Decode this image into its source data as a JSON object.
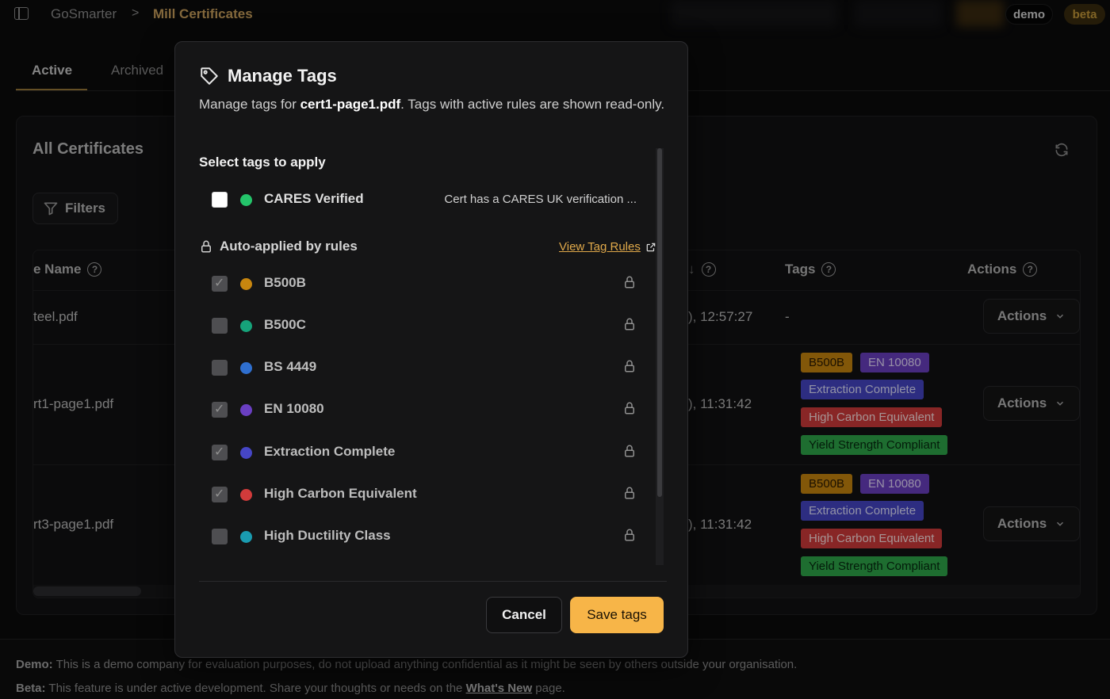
{
  "breadcrumb": {
    "home": "GoSmarter",
    "separator": ">",
    "current": "Mill Certificates"
  },
  "badges": {
    "demo": "demo",
    "beta": "beta"
  },
  "tabs": [
    {
      "label": "Active"
    },
    {
      "label": "Archived"
    }
  ],
  "card": {
    "title": "All Certificates",
    "filters_label": "Filters"
  },
  "table": {
    "columns": {
      "name": "e Name",
      "date_sort": "↓",
      "tags": "Tags",
      "actions": "Actions"
    },
    "rows": [
      {
        "name": "teel.pdf",
        "date": "), 12:57:27",
        "tags_empty": "-",
        "action": "Actions"
      },
      {
        "name": "rt1-page1.pdf",
        "date": "), 11:31:42",
        "action": "Actions"
      },
      {
        "name": "rt3-page1.pdf",
        "date": "), 11:31:42",
        "action": "Actions"
      }
    ],
    "tag_chips": [
      "B500B",
      "EN 10080",
      "Extraction Complete",
      "High Carbon Equivalent",
      "Yield Strength Compliant"
    ]
  },
  "colors": {
    "accent": "#f7b548",
    "tag_b500b": "#c8860f",
    "tag_en10080": "#6a3fc2",
    "tag_extraction": "#4646c6",
    "tag_highcarbon": "#d23b3b",
    "tag_yield": "#2fa84a",
    "dot_teal": "#16a37a",
    "dot_blue": "#2f6fcf",
    "dot_cyan": "#1a9bb0"
  },
  "footer": {
    "demo_label": "Demo:",
    "demo_text": " This is a demo company for evaluation purposes, do not upload anything confidential as it might be seen by others outside your organisation.",
    "beta_label": "Beta:",
    "beta_text": " This feature is under active development. Share your thoughts or needs on the ",
    "beta_link": "What's New",
    "beta_end": " page."
  },
  "modal": {
    "title": "Manage Tags",
    "desc_prefix": "Manage tags for ",
    "filename": "cert1-page1.pdf",
    "desc_suffix": ". Tags with active rules are shown read-only.",
    "select_heading": "Select tags to apply",
    "manual_tags": [
      {
        "name": "CARES Verified",
        "description": "Cert has a CARES UK verification ..."
      }
    ],
    "auto_heading": "Auto-applied by rules",
    "rules_link": "View Tag Rules",
    "auto_tags": [
      {
        "name": "B500B",
        "checked": true
      },
      {
        "name": "B500C",
        "checked": false
      },
      {
        "name": "BS 4449",
        "checked": false
      },
      {
        "name": "EN 10080",
        "checked": true
      },
      {
        "name": "Extraction Complete",
        "checked": true
      },
      {
        "name": "High Carbon Equivalent",
        "checked": true
      },
      {
        "name": "High Ductility Class",
        "checked": false
      }
    ],
    "cancel_label": "Cancel",
    "save_label": "Save tags"
  }
}
